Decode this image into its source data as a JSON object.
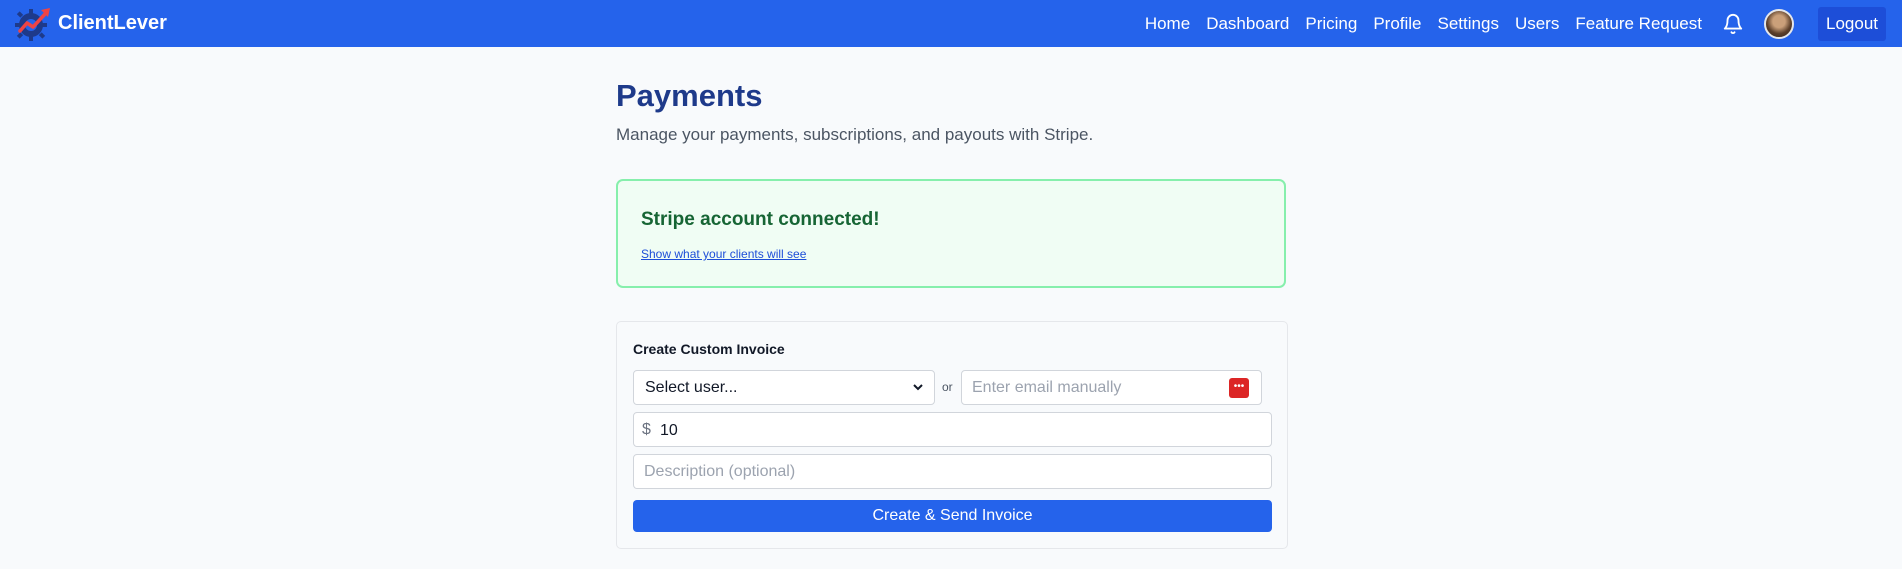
{
  "navbar": {
    "brand": "ClientLever",
    "links": [
      "Home",
      "Dashboard",
      "Pricing",
      "Profile",
      "Settings",
      "Users",
      "Feature Request"
    ],
    "logout": "Logout",
    "icons": {
      "logo": "rocket-gear-logo",
      "bell": "bell-icon",
      "avatar": "user-avatar"
    }
  },
  "page": {
    "title": "Payments",
    "subtitle": "Manage your payments, subscriptions, and payouts with Stripe."
  },
  "alert": {
    "title": "Stripe account connected!",
    "link": "Show what your clients will see"
  },
  "invoice": {
    "title": "Create Custom Invoice",
    "select_value": "Select user...",
    "or": "or",
    "email_placeholder": "Enter email manually",
    "currency": "$",
    "amount": "10",
    "description_placeholder": "Description (optional)",
    "submit": "Create & Send Invoice"
  },
  "colors": {
    "primary": "#2563eb",
    "title": "#1e3a8a",
    "success_bg": "#f0fdf4",
    "success_border": "#86efac",
    "success_text": "#166534"
  }
}
